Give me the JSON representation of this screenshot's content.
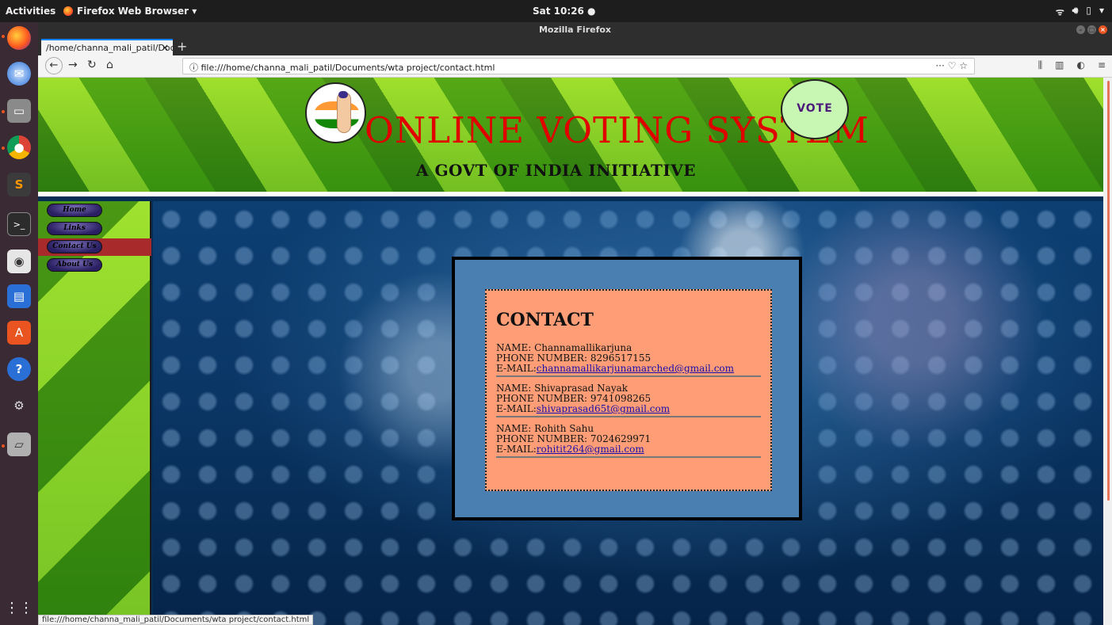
{
  "os": {
    "activities": "Activities",
    "app_menu": "Firefox Web Browser ▾",
    "clock": "Sat 10:26 ●",
    "sys_icons": [
      "wifi-icon",
      "volume-icon",
      "battery-icon",
      "menu-caret-icon"
    ]
  },
  "browser": {
    "window_title": "Mozilla Firefox",
    "tab_title": "/home/channa_mali_patil/Docu",
    "url": "file:///home/channa_mali_patil/Documents/wta project/contact.html",
    "status_url": "file:///home/channa_mali_patil/Documents/wta project/contact.html",
    "accent_color": "#0a84ff"
  },
  "header": {
    "title": "ONLINE VOTING SYSTEM",
    "subtitle": "A GOVT OF INDIA INITIATIVE",
    "vote_badge": "VOTE",
    "title_color": "#e00000"
  },
  "sidebar": {
    "items": [
      {
        "label": "Home",
        "active": false
      },
      {
        "label": "Links",
        "active": false
      },
      {
        "label": "Contact Us",
        "active": true
      },
      {
        "label": "About Us",
        "active": false
      }
    ]
  },
  "contact": {
    "heading": "CONTACT",
    "entries": [
      {
        "name": "NAME: Channamallikarjuna",
        "phone": "PHONE NUMBER: 8296517155",
        "email_label": "E-MAIL:",
        "email": "channamallikarjunamarched@gmail.com"
      },
      {
        "name": "NAME: Shivaprasad Nayak",
        "phone": "PHONE NUMBER: 9741098265",
        "email_label": "E-MAIL:",
        "email": "shivaprasad65t@gmail.com"
      },
      {
        "name": "NAME: Rohith Sahu",
        "phone": "PHONE NUMBER: 7024629971",
        "email_label": "E-MAIL:",
        "email": "rohitit264@gmail.com"
      }
    ]
  }
}
